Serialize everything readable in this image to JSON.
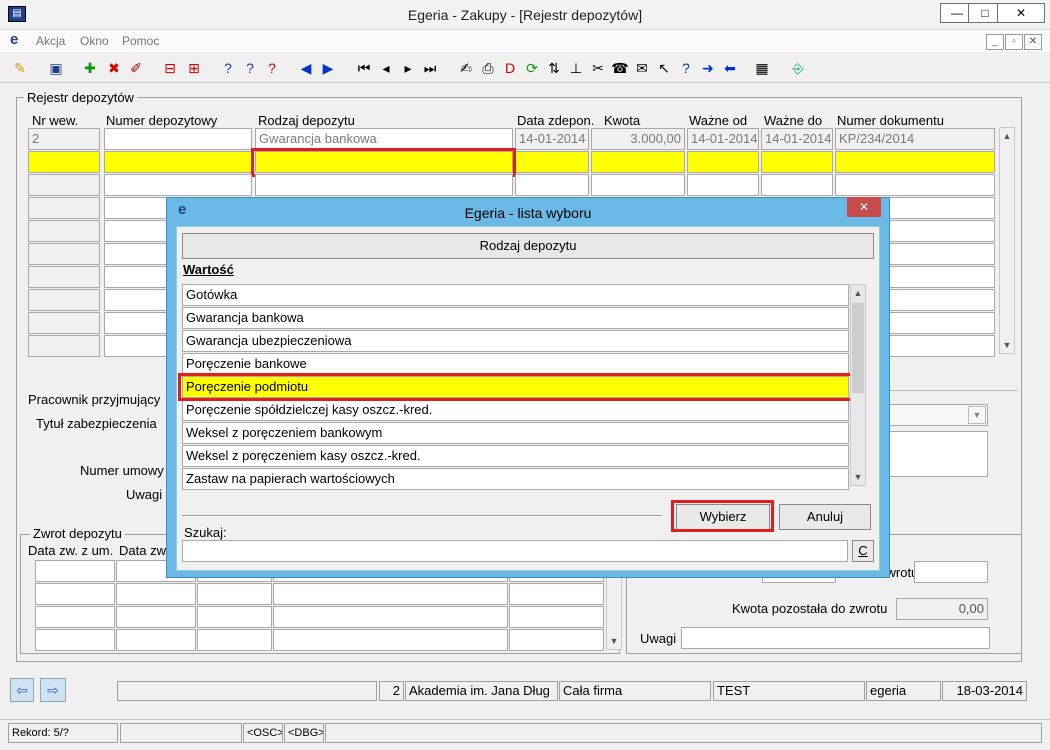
{
  "window": {
    "title": "Egeria - Zakupy - [Rejestr depozytów]",
    "minimize": "—",
    "maximize": "□",
    "close": "✕"
  },
  "menu": {
    "logo": "e",
    "items": [
      "Akcja",
      "Okno",
      "Pomoc"
    ]
  },
  "register": {
    "group_label": "Rejestr depozytów",
    "columns": [
      "Nr wew.",
      "Numer depozytowy",
      "Rodzaj depozytu",
      "Data zdepon.",
      "Kwota",
      "Ważne od",
      "Ważne do",
      "Numer dokumentu"
    ],
    "row1": [
      "2",
      "",
      "Gwarancja bankowa",
      "14-01-2014",
      "3.000,00",
      "14-01-2014",
      "14-01-2014",
      "KP/234/2014"
    ]
  },
  "form": {
    "pracownik": "Pracownik przyjmujący",
    "tytul": "Tytuł zabezpieczenia",
    "numer_umowy": "Numer umowy",
    "uwagi": "Uwagi"
  },
  "zwrot": {
    "group_label": "Zwrot depozytu",
    "col1": "Data zw. z um.",
    "col2": "Data zw",
    "zwrotu_label": "zwrotu",
    "kwota_label": "Kwota pozostała do zwrotu",
    "kwota_value": "0,00",
    "uwagi": "Uwagi"
  },
  "dialog": {
    "logo": "e",
    "title": "Egeria - lista wyboru",
    "close": "✕",
    "header": "Rodzaj depozytu",
    "column_label": "Wartość",
    "items": [
      "Gotówka",
      "Gwarancja bankowa",
      "Gwarancja ubezpieczeniowa",
      "Poręczenie bankowe",
      "Poręczenie podmiotu",
      "Poręczenie spółdzielczej kasy oszcz.-kred.",
      "Weksel z poręczeniem bankowym",
      "Weksel z poręczeniem kasy oszcz.-kred.",
      "Zastaw na papierach wartościowych"
    ],
    "select_button": "Wybierz",
    "cancel_button": "Anuluj",
    "search_label": "Szukaj:",
    "search_value": "",
    "clear_button": "C"
  },
  "statusbar": {
    "number": "2",
    "org": "Akademia im. Jana Dług",
    "scope": "Cała firma",
    "env": "TEST",
    "user": "egeria",
    "date": "18-03-2014",
    "record": "Rekord: 5/?",
    "osc": "<OSC>",
    "dbg": "<DBG>"
  }
}
